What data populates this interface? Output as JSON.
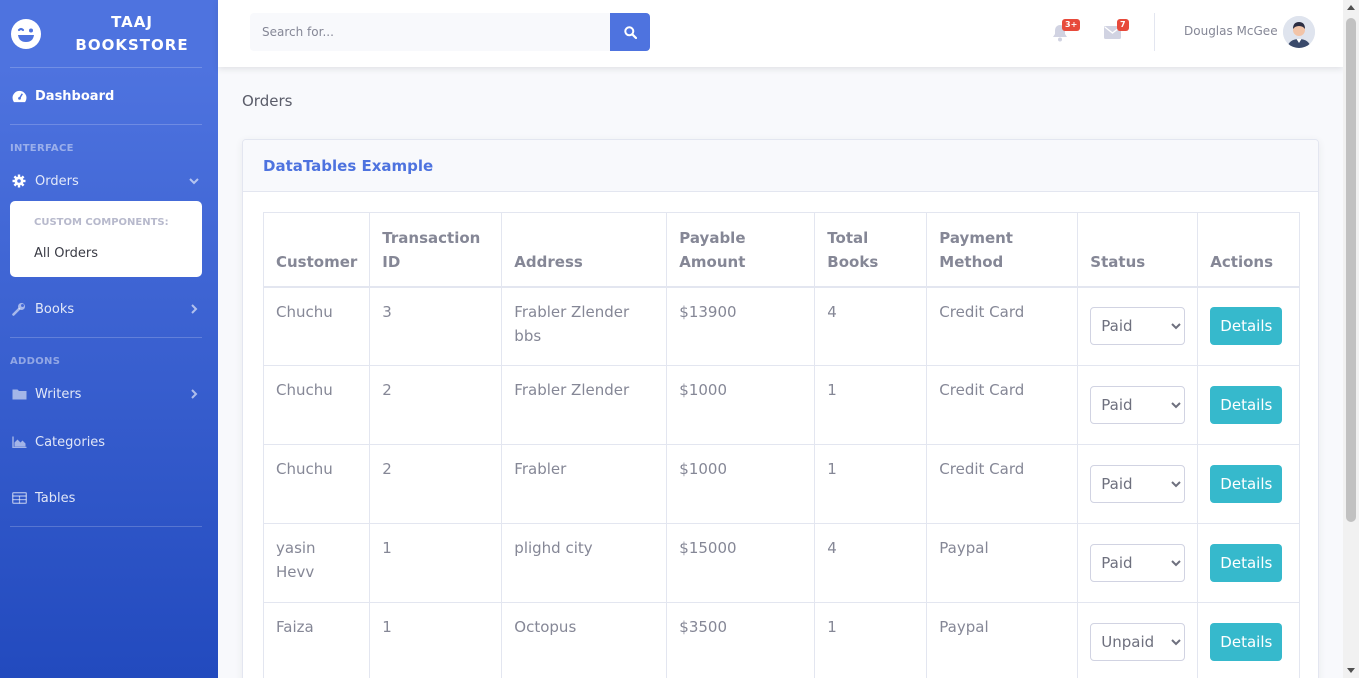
{
  "brand": {
    "line1": "TAAJ",
    "line2": "BOOKSTORE"
  },
  "sidebar": {
    "dashboard": "Dashboard",
    "heading_interface": "INTERFACE",
    "orders": "Orders",
    "orders_submenu": {
      "header": "CUSTOM COMPONENTS:",
      "items": [
        {
          "label": "All Orders"
        }
      ]
    },
    "books": "Books",
    "heading_addons": "ADDONS",
    "writers": "Writers",
    "categories": "Categories",
    "tables": "Tables"
  },
  "topbar": {
    "search_placeholder": "Search for...",
    "alerts_count": "3+",
    "messages_count": "7",
    "user_name": "Douglas McGee"
  },
  "page": {
    "title": "Orders"
  },
  "card": {
    "title": "DataTables Example"
  },
  "table": {
    "headers": [
      "Customer",
      "Transaction ID",
      "Address",
      "Payable Amount",
      "Total Books",
      "Payment Method",
      "Status",
      "Actions"
    ],
    "rows": [
      {
        "customer": "Chuchu",
        "transaction_id": "3",
        "address": "Frabler Zlender bbs",
        "amount": "$13900",
        "books": "4",
        "payment": "Credit Card",
        "status": "Paid",
        "action": "Details"
      },
      {
        "customer": "Chuchu",
        "transaction_id": "2",
        "address": "Frabler Zlender",
        "amount": "$1000",
        "books": "1",
        "payment": "Credit Card",
        "status": "Paid",
        "action": "Details"
      },
      {
        "customer": "Chuchu",
        "transaction_id": "2",
        "address": "Frabler",
        "amount": "$1000",
        "books": "1",
        "payment": "Credit Card",
        "status": "Paid",
        "action": "Details"
      },
      {
        "customer": "yasin Hevv",
        "transaction_id": "1",
        "address": "plighd city",
        "amount": "$15000",
        "books": "4",
        "payment": "Paypal",
        "status": "Paid",
        "action": "Details"
      },
      {
        "customer": "Faiza",
        "transaction_id": "1",
        "address": "Octopus",
        "amount": "$3500",
        "books": "1",
        "payment": "Paypal",
        "status": "Unpaid",
        "action": "Details"
      }
    ]
  },
  "colors": {
    "primary": "#4e73df",
    "info": "#36b9cc",
    "danger": "#e74a3b"
  }
}
